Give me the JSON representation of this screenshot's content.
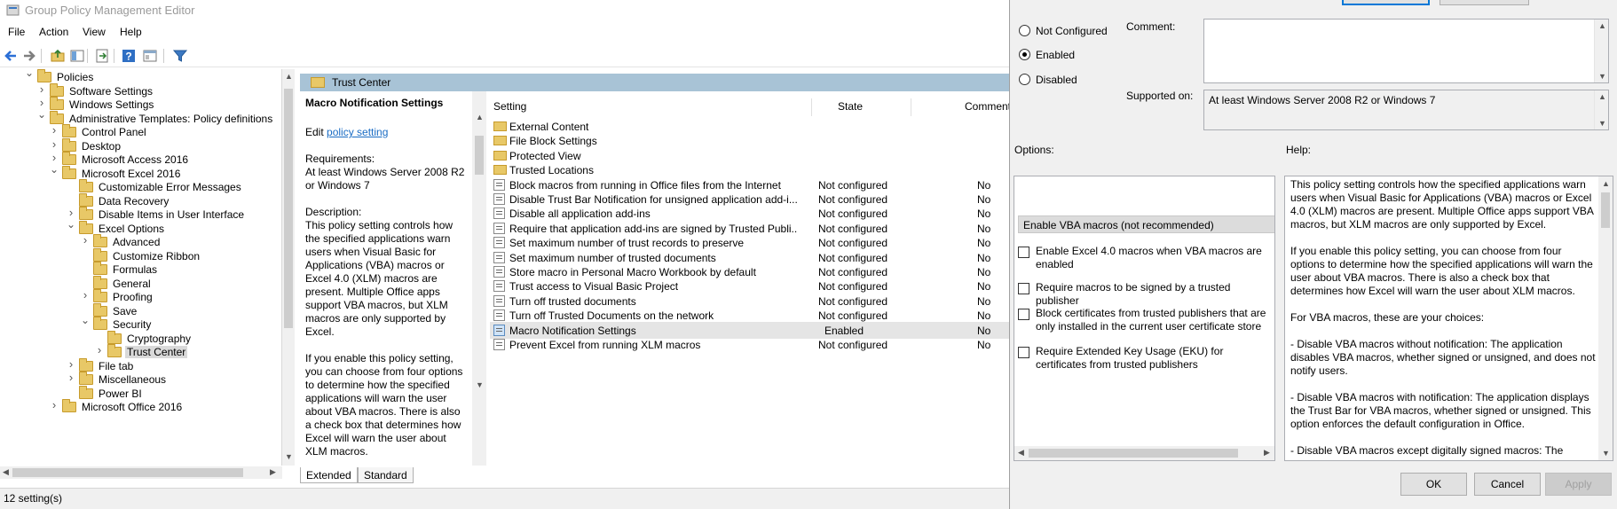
{
  "window": {
    "title": "Group Policy Management Editor"
  },
  "menu": [
    "File",
    "Action",
    "View",
    "Help"
  ],
  "tree": {
    "nodes": [
      {
        "label": "Policies",
        "depth": 1,
        "twist": "open"
      },
      {
        "label": "Software Settings",
        "depth": 2,
        "twist": "closed"
      },
      {
        "label": "Windows Settings",
        "depth": 2,
        "twist": "closed"
      },
      {
        "label": "Administrative Templates: Policy definitions",
        "depth": 2,
        "twist": "open"
      },
      {
        "label": "Control Panel",
        "depth": 3,
        "twist": "closed"
      },
      {
        "label": "Desktop",
        "depth": 3,
        "twist": "closed"
      },
      {
        "label": "Microsoft Access 2016",
        "depth": 3,
        "twist": "closed"
      },
      {
        "label": "Microsoft Excel 2016",
        "depth": 3,
        "twist": "open"
      },
      {
        "label": "Customizable Error Messages",
        "depth": 4,
        "twist": "none"
      },
      {
        "label": "Data Recovery",
        "depth": 4,
        "twist": "none"
      },
      {
        "label": "Disable Items in User Interface",
        "depth": 4,
        "twist": "closed"
      },
      {
        "label": "Excel Options",
        "depth": 4,
        "twist": "open"
      },
      {
        "label": "Advanced",
        "depth": 5,
        "twist": "closed"
      },
      {
        "label": "Customize Ribbon",
        "depth": 5,
        "twist": "none"
      },
      {
        "label": "Formulas",
        "depth": 5,
        "twist": "none"
      },
      {
        "label": "General",
        "depth": 5,
        "twist": "none"
      },
      {
        "label": "Proofing",
        "depth": 5,
        "twist": "closed"
      },
      {
        "label": "Save",
        "depth": 5,
        "twist": "none"
      },
      {
        "label": "Security",
        "depth": 5,
        "twist": "open"
      },
      {
        "label": "Cryptography",
        "depth": 6,
        "twist": "none"
      },
      {
        "label": "Trust Center",
        "depth": 6,
        "twist": "closed",
        "selected": true
      },
      {
        "label": "File tab",
        "depth": 4,
        "twist": "closed"
      },
      {
        "label": "Miscellaneous",
        "depth": 4,
        "twist": "closed"
      },
      {
        "label": "Power BI",
        "depth": 4,
        "twist": "none"
      },
      {
        "label": "Microsoft Office 2016",
        "depth": 3,
        "twist": "closed"
      }
    ]
  },
  "pane": {
    "header": "Trust Center",
    "desc": {
      "title": "Macro Notification Settings",
      "edit_prefix": "Edit",
      "edit_link": "policy setting",
      "req_label": "Requirements:",
      "req_text": "At least Windows Server 2008 R2 or Windows 7",
      "desc_label": "Description:",
      "desc_p1": "This policy setting controls how the specified applications warn users when Visual Basic for Applications (VBA) macros or Excel 4.0 (XLM) macros are present. Multiple Office apps support VBA macros, but XLM macros are only supported by Excel.",
      "desc_p2": "If you enable this policy setting, you can choose from four options to determine how the specified applications will warn the user about VBA macros. There is also a check box that determines how Excel will warn the user about XLM macros."
    },
    "columns": {
      "setting": "Setting",
      "state": "State",
      "comment": "Comment"
    },
    "folders": [
      "External Content",
      "File Block Settings",
      "Protected View",
      "Trusted Locations"
    ],
    "rows": [
      {
        "name": "Block macros from running in Office files from the Internet",
        "state": "Not configured",
        "comment": "No"
      },
      {
        "name": "Disable Trust Bar Notification for unsigned application add-i...",
        "state": "Not configured",
        "comment": "No"
      },
      {
        "name": "Disable all application add-ins",
        "state": "Not configured",
        "comment": "No"
      },
      {
        "name": "Require that application add-ins are signed by Trusted Publi...",
        "state": "Not configured",
        "comment": "No"
      },
      {
        "name": "Set maximum number of trust records to preserve",
        "state": "Not configured",
        "comment": "No"
      },
      {
        "name": "Set maximum number of trusted documents",
        "state": "Not configured",
        "comment": "No"
      },
      {
        "name": "Store macro in Personal Macro Workbook by default",
        "state": "Not configured",
        "comment": "No"
      },
      {
        "name": "Trust access to Visual Basic Project",
        "state": "Not configured",
        "comment": "No"
      },
      {
        "name": "Turn off trusted documents",
        "state": "Not configured",
        "comment": "No"
      },
      {
        "name": "Turn off Trusted Documents on the network",
        "state": "Not configured",
        "comment": "No"
      },
      {
        "name": "Macro Notification Settings",
        "state": "Enabled",
        "comment": "No",
        "selected": true
      },
      {
        "name": "Prevent Excel from running XLM macros",
        "state": "Not configured",
        "comment": "No"
      }
    ],
    "tabs": [
      "Extended",
      "Standard"
    ]
  },
  "status": "12 setting(s)",
  "dialog": {
    "radios": [
      {
        "label": "Not Configured",
        "checked": false
      },
      {
        "label": "Enabled",
        "checked": true
      },
      {
        "label": "Disabled",
        "checked": false
      }
    ],
    "comment_label": "Comment:",
    "supported_label": "Supported on:",
    "supported_value": "At least Windows Server 2008 R2 or Windows 7",
    "options_label": "Options:",
    "help_label": "Help:",
    "options_select": "Enable VBA macros (not recommended)",
    "checkboxes": [
      "Enable Excel 4.0 macros when VBA macros are enabled",
      "Require macros to be signed by a trusted publisher",
      "Block certificates from trusted publishers that are only installed in the current user certificate store",
      "Require Extended Key Usage (EKU) for certificates from trusted publishers"
    ],
    "help": [
      "This policy setting controls how the specified applications warn users when Visual Basic for Applications (VBA) macros or Excel 4.0 (XLM) macros are present. Multiple Office apps support VBA macros, but XLM macros are only supported by Excel.",
      "If you enable this policy setting, you can choose from four options to determine how the specified applications will warn the user about VBA macros. There is also a check box that determines how Excel will warn the user about XLM macros.",
      "For VBA macros, these are your choices:",
      "- Disable VBA macros without notification: The application disables VBA macros, whether signed or unsigned, and does not notify users.",
      "- Disable VBA macros with notification: The application displays the Trust Bar for VBA macros, whether signed or unsigned. This option enforces the default configuration in Office.",
      "- Disable VBA macros except digitally signed macros: The"
    ],
    "ok": "OK",
    "cancel": "Cancel",
    "apply": "Apply"
  }
}
